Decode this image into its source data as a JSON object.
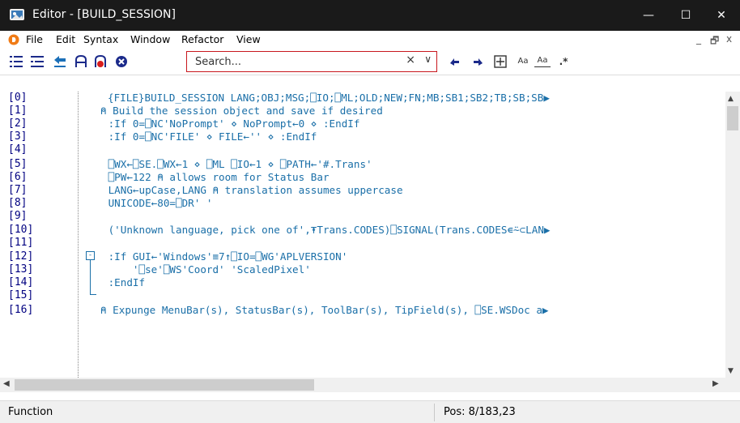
{
  "window": {
    "title": "Editor - [BUILD_SESSION]",
    "minimize": "—",
    "maximize": "☐",
    "close": "✕"
  },
  "menubar": {
    "items": [
      "File",
      "Edit",
      "Syntax",
      "Window",
      "Refactor",
      "View"
    ],
    "mdi_minimize": "_",
    "mdi_restore": "🗗",
    "mdi_close": "x"
  },
  "toolbar": {
    "search_placeholder": "Search...",
    "search_clear": "×",
    "search_dropdown": "∨",
    "aa_label": "Aa",
    "aa_box_label": "Aa",
    "regex_label": ".*",
    "icons": [
      "outline-icon",
      "list-icon",
      "back-arrow-icon",
      "bookmark-icon",
      "bookmark-red-icon",
      "stop-icon",
      "prev-match-icon",
      "next-match-icon",
      "expand-icon",
      "match-case-icon",
      "whole-word-icon",
      "regex-icon"
    ]
  },
  "editor": {
    "line_numbers": [
      "[0]",
      "[1]",
      "[2]",
      "[3]",
      "[4]",
      "[5]",
      "[6]",
      "[7]",
      "[8]",
      "[9]",
      "[10]",
      "[11]",
      "[12]",
      "[13]",
      "[14]",
      "[15]",
      "[16]"
    ],
    "lines": [
      "{FILE}BUILD_SESSION LANG;OBJ;MSG;⎕IO;⎕ML;OLD;NEW;FN;MB;SB1;SB2;TB;SB;SB▶",
      "⍝ Build the session object and save if desired",
      " :If 0=⎕NC'NoPrompt' ⋄ NoPrompt←0 ⋄ :EndIf",
      " :If 0=⎕NC'FILE' ⋄ FILE←'' ⋄ :EndIf",
      "",
      " ⎕WX←⎕SE.⎕WX←1 ⋄ ⎕ML ⎕IO←1 ⋄ ⎕PATH←'#.Trans'",
      " ⎕PW←122 ⍝ allows room for Status Bar",
      " LANG←upCase,LANG ⍝ translation assumes uppercase",
      " UNICODE←80=⎕DR' '",
      "",
      " ('Unknown language, pick one of',⍕Trans.CODES)⎕SIGNAL(Trans.CODES∊⍨⊂LAN▶",
      "",
      " :If GUI←'Windows'≡7↑⎕IO=⎕WG'APLVERSION'",
      "     '⎕se'⎕WS'Coord' 'ScaledPixel'",
      " :EndIf",
      "",
      "⍝ Expunge MenuBar(s), StatusBar(s), ToolBar(s), TipField(s), ⎕SE.WSDoc a▶"
    ],
    "fold_marker": "-"
  },
  "status": {
    "mode": "Function",
    "position": "Pos: 8/183,23"
  },
  "colors": {
    "titlebar": "#1a1a1a",
    "line_number": "#000080",
    "code": "#1a6fa8",
    "comment": "#1c8c1c",
    "search_border": "#c8181e"
  }
}
